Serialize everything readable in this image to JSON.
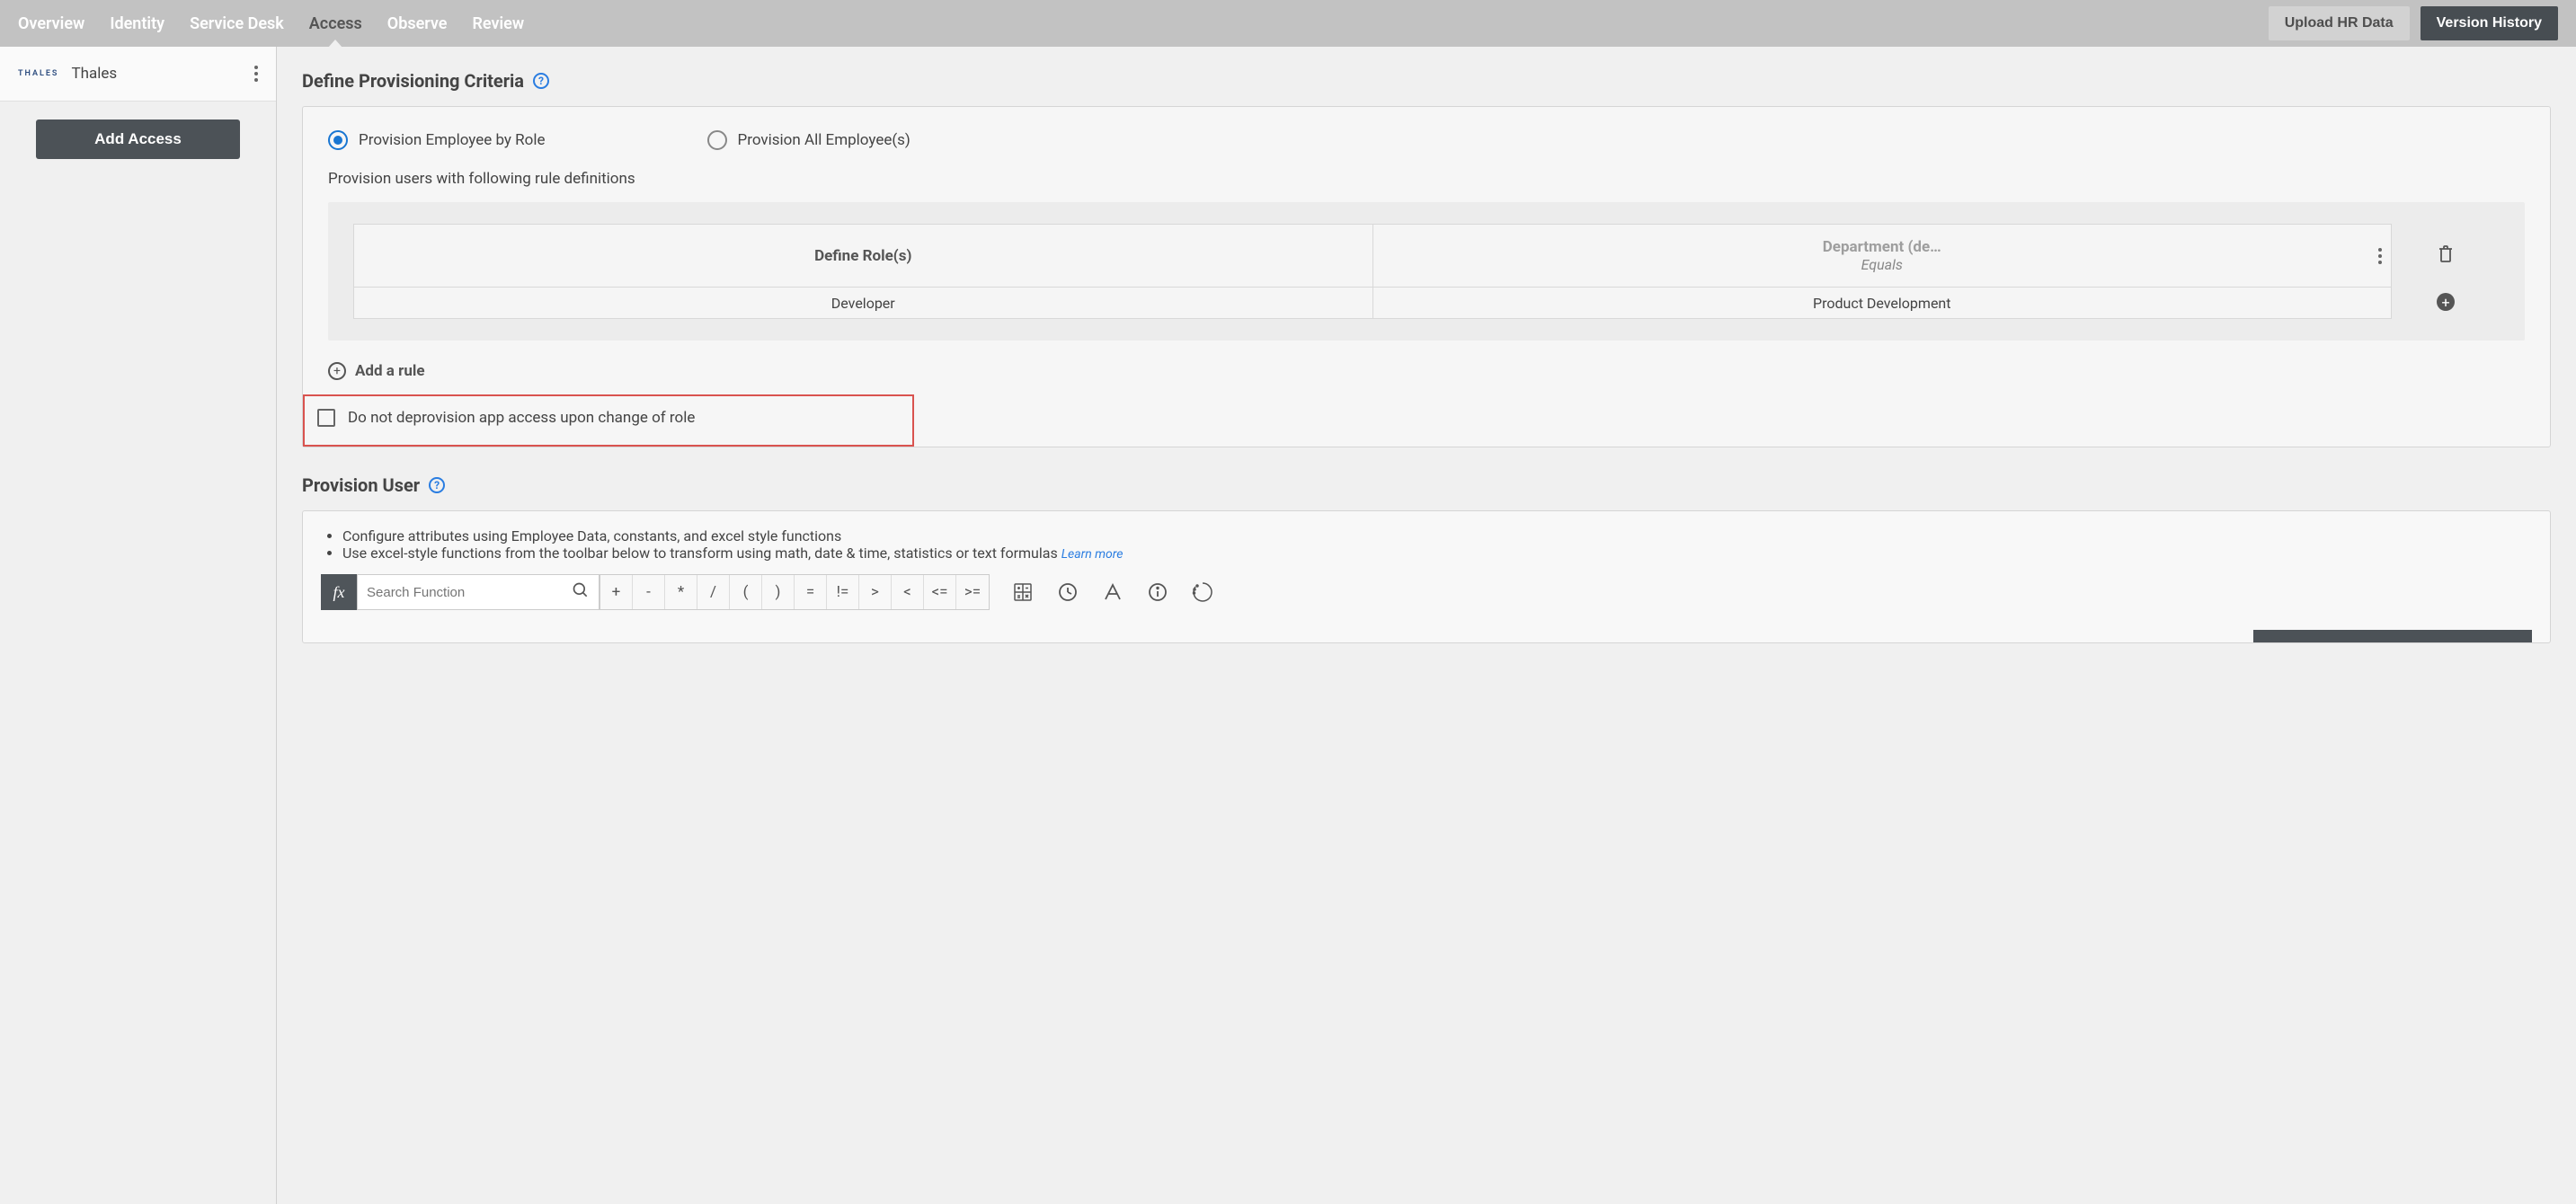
{
  "topnav": {
    "tabs": [
      "Overview",
      "Identity",
      "Service Desk",
      "Access",
      "Observe",
      "Review"
    ],
    "active": "Access",
    "upload_hr": "Upload HR Data",
    "version_history": "Version History"
  },
  "sidebar": {
    "item_logo_text": "THALES",
    "item_label": "Thales",
    "add_access": "Add Access"
  },
  "section1": {
    "title": "Define Provisioning Criteria",
    "radio_by_role": "Provision Employee by Role",
    "radio_all": "Provision All Employee(s)",
    "sub_label": "Provision users with following rule definitions",
    "col1_header": "Define Role(s)",
    "col2_header_title": "Department (de…",
    "col2_header_sub": "Equals",
    "row_role": "Developer",
    "row_dept": "Product Development",
    "add_rule": "Add a rule",
    "checkbox_label": "Do not deprovision app access upon change of role"
  },
  "section2": {
    "title": "Provision User",
    "bullets": [
      "Configure attributes using Employee Data, constants, and excel style functions",
      "Use excel-style functions from the toolbar below to transform using math, date & time, statistics or text formulas"
    ],
    "learn_more": "Learn more",
    "fx_label": "fx",
    "search_placeholder": "Search Function",
    "operators": [
      "+",
      "-",
      "*",
      "/",
      "(",
      ")",
      "=",
      "!=",
      ">",
      "<",
      "<=",
      ">="
    ]
  }
}
